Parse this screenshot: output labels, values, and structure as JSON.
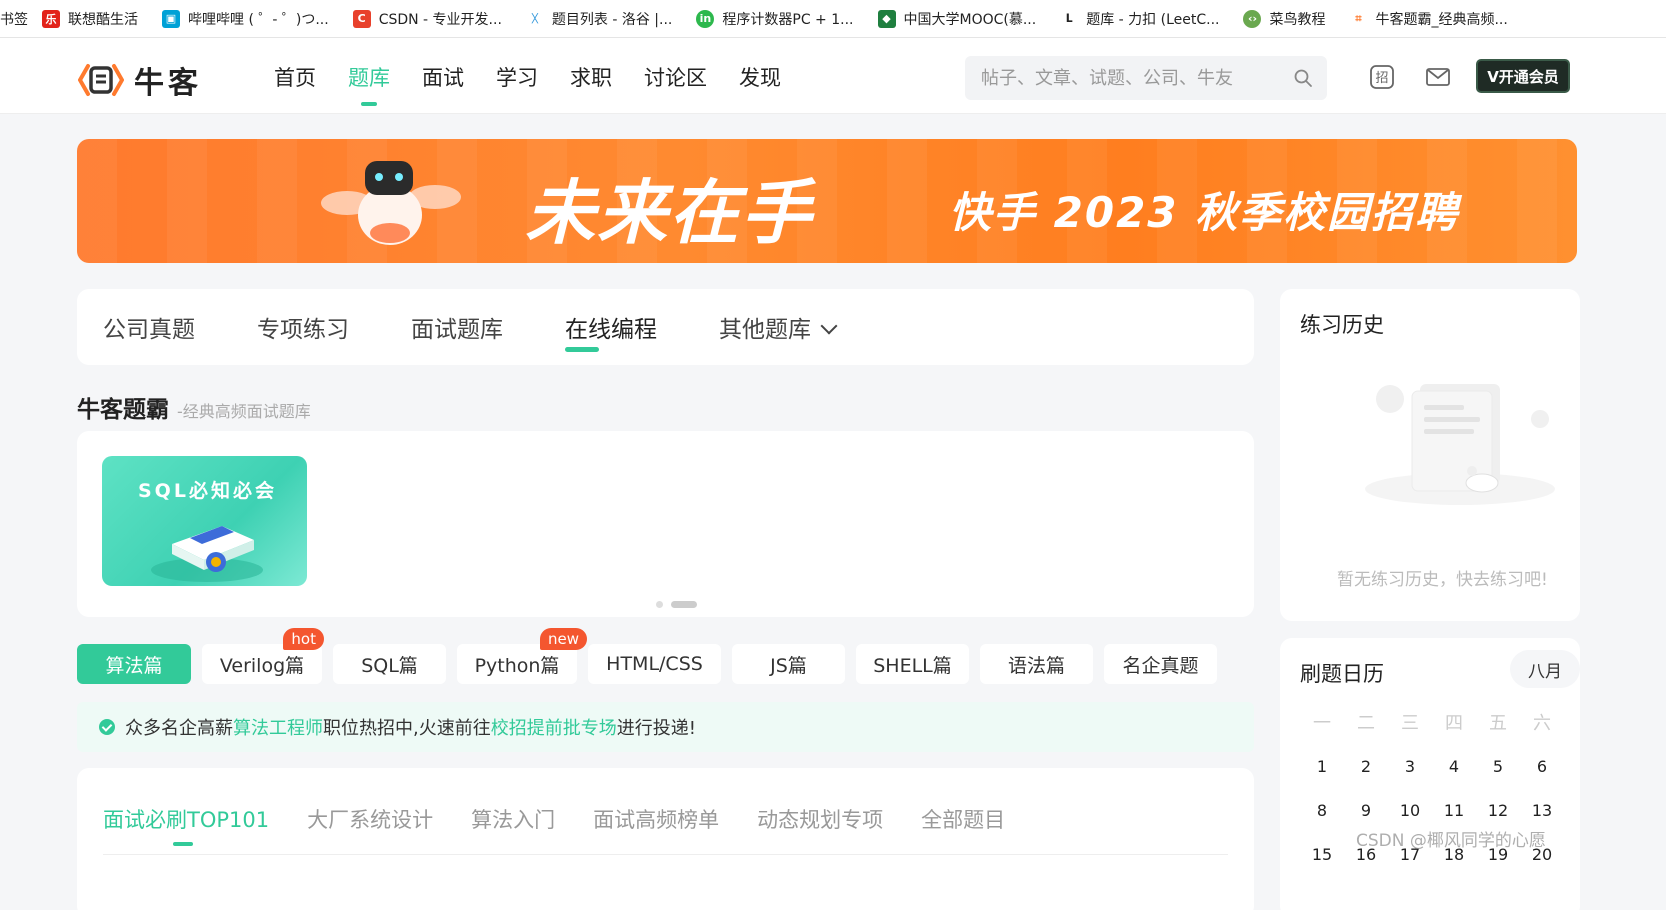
{
  "bookmarks": [
    {
      "label": "书签",
      "icon": "none",
      "color": ""
    },
    {
      "label": "联想酷生活",
      "icon": "lenovo-icon",
      "color": "#e2231a"
    },
    {
      "label": "哔哩哔哩 ( ゜- ゜)つ...",
      "icon": "bilibili-icon",
      "color": "#00a1d6"
    },
    {
      "label": "CSDN - 专业开发...",
      "icon": "csdn-icon",
      "color": "#e8412c"
    },
    {
      "label": "题目列表 - 洛谷 |...",
      "icon": "luogu-icon",
      "color": "#3498db"
    },
    {
      "label": "程序计数器PC + 1...",
      "icon": "infoq-icon",
      "color": "#2db84d"
    },
    {
      "label": "中国大学MOOC(慕...",
      "icon": "mooc-icon",
      "color": "#1f7f3f"
    },
    {
      "label": "题库 - 力扣 (LeetC...",
      "icon": "leetcode-icon",
      "color": "#222222"
    },
    {
      "label": "菜鸟教程",
      "icon": "runoob-icon",
      "color": "#6aa84f"
    },
    {
      "label": "牛客题霸_经典高频...",
      "icon": "nowcoder-icon",
      "color": "#ff7a2e"
    }
  ],
  "header": {
    "logo_text": "牛客",
    "nav": [
      "首页",
      "题库",
      "面试",
      "学习",
      "求职",
      "讨论区",
      "发现"
    ],
    "active_nav": "题库",
    "search_placeholder": "帖子、文章、试题、公司、牛友",
    "vip_label": "V开通会员"
  },
  "banner": {
    "slogan": "未来在手",
    "title": "快手 2023 秋季校园招聘"
  },
  "subtabs": {
    "items": [
      "公司真题",
      "专项练习",
      "面试题库",
      "在线编程",
      "其他题库"
    ],
    "active": "在线编程"
  },
  "section": {
    "title": "牛客题霸",
    "subtitle": "-经典高频面试题库"
  },
  "carousel": {
    "card_title": "SQL必知必会"
  },
  "languages": [
    {
      "label": "算法篇",
      "badge": ""
    },
    {
      "label": "Verilog篇",
      "badge": "hot"
    },
    {
      "label": "SQL篇",
      "badge": ""
    },
    {
      "label": "Python篇",
      "badge": "new"
    },
    {
      "label": "HTML/CSS",
      "badge": ""
    },
    {
      "label": "JS篇",
      "badge": ""
    },
    {
      "label": "SHELL篇",
      "badge": ""
    },
    {
      "label": "语法篇",
      "badge": ""
    },
    {
      "label": "名企真题",
      "badge": ""
    }
  ],
  "active_language": "算法篇",
  "notice": {
    "text1": "众多名企高薪",
    "link1": "算法工程师",
    "text2": "职位热招中,火速前往",
    "link2": "校招提前批专场",
    "text3": "进行投递!"
  },
  "problem_tabs": {
    "items": [
      "面试必刷TOP101",
      "大厂系统设计",
      "算法入门",
      "面试高频榜单",
      "动态规划专项",
      "全部题目"
    ],
    "active": "面试必刷TOP101"
  },
  "history": {
    "title": "练习历史",
    "empty_text": "暂无练习历史，快去练习吧!"
  },
  "calendar": {
    "title": "刷题日历",
    "month": "八月",
    "weekdays": [
      "一",
      "二",
      "三",
      "四",
      "五",
      "六"
    ],
    "weeks": [
      [
        "1",
        "2",
        "3",
        "4",
        "5",
        "6"
      ],
      [
        "8",
        "9",
        "10",
        "11",
        "12",
        "13"
      ],
      [
        "15",
        "16",
        "17",
        "18",
        "19",
        "20"
      ]
    ]
  },
  "watermark": "CSDN @椰风同学的心愿",
  "colors": {
    "accent": "#32ca99",
    "banner_orange": "#ff7a2e",
    "badge_red": "#f4562f"
  }
}
